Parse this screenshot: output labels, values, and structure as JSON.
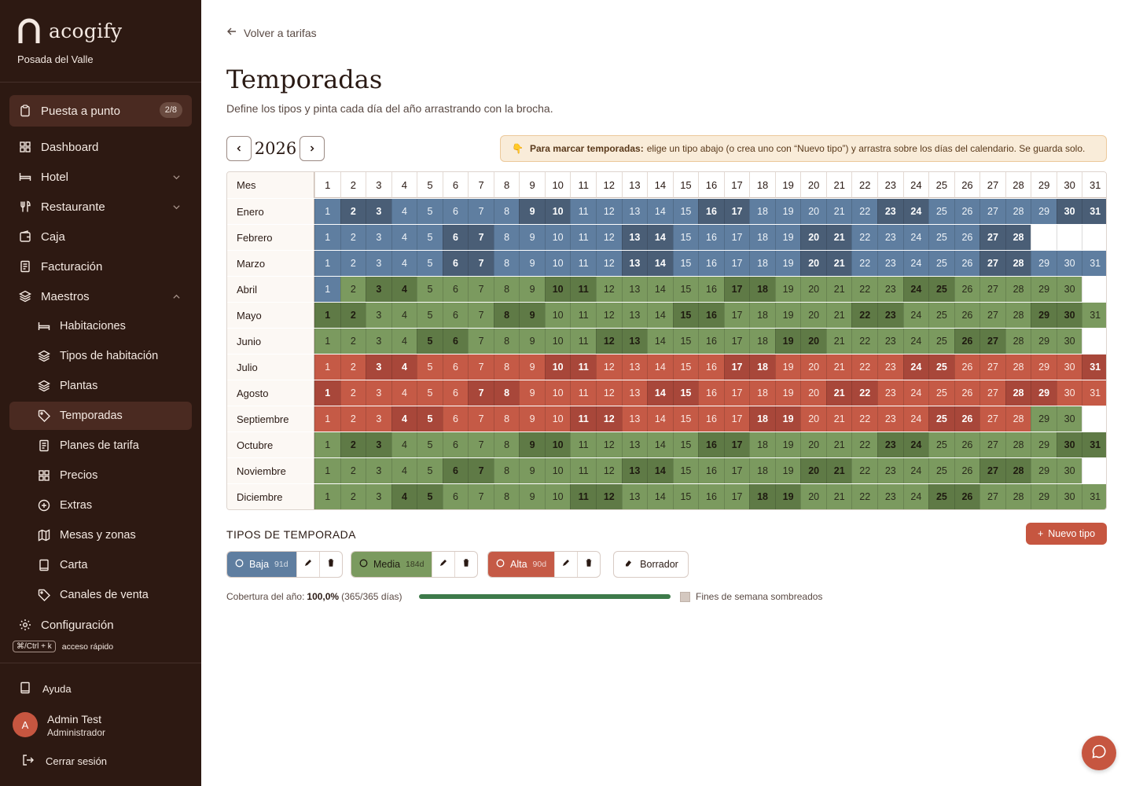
{
  "sidebar": {
    "brand": "acogify",
    "hotel": "Posada del Valle",
    "setup": {
      "label": "Puesta a punto",
      "badge": "2/8"
    },
    "items": [
      {
        "label": "Dashboard",
        "icon": "grid-icon"
      },
      {
        "label": "Hotel",
        "icon": "bed-icon"
      },
      {
        "label": "Restaurante",
        "icon": "utensils-icon"
      },
      {
        "label": "Caja",
        "icon": "wallet-icon"
      },
      {
        "label": "Facturación",
        "icon": "receipt-icon"
      },
      {
        "label": "Maestros",
        "icon": "layers-icon"
      },
      {
        "label": "Habitaciones",
        "icon": "bed-icon"
      },
      {
        "label": "Tipos de habitación",
        "icon": "layers-icon"
      },
      {
        "label": "Plantas",
        "icon": "layers-icon"
      },
      {
        "label": "Temporadas",
        "icon": "tag-icon"
      },
      {
        "label": "Planes de tarifa",
        "icon": "document-icon"
      },
      {
        "label": "Precios",
        "icon": "grid-icon"
      },
      {
        "label": "Extras",
        "icon": "plus-circle-icon"
      },
      {
        "label": "Mesas y zonas",
        "icon": "map-icon"
      },
      {
        "label": "Carta",
        "icon": "book-icon"
      },
      {
        "label": "Canales de venta",
        "icon": "tag-icon"
      },
      {
        "label": "Configuración",
        "icon": "gear-icon"
      }
    ],
    "shortcut": {
      "key": "⌘/Ctrl + k",
      "label": "acceso rápido"
    },
    "help": "Ayuda",
    "user": {
      "initial": "A",
      "name": "Admin Test",
      "role": "Administrador"
    },
    "logout": "Cerrar sesión"
  },
  "page": {
    "back": "Volver a tarifas",
    "title": "Temporadas",
    "subtitle": "Define los tipos y pinta cada día del año arrastrando con la brocha.",
    "year": "2026",
    "hint_icon": "👇",
    "hint_bold": "Para marcar temporadas:",
    "hint_text": "elige un tipo abajo (o crea uno con “Nuevo tipo”) y arrastra sobre los días del calendario. Se guarda solo."
  },
  "calendar": {
    "header_label": "Mes",
    "months": [
      "Enero",
      "Febrero",
      "Marzo",
      "Abril",
      "Mayo",
      "Junio",
      "Julio",
      "Agosto",
      "Septiembre",
      "Octubre",
      "Noviembre",
      "Diciembre"
    ],
    "days_in_month": [
      31,
      28,
      31,
      30,
      31,
      30,
      31,
      31,
      30,
      31,
      30,
      31
    ],
    "first_weekday_2026": 4,
    "season_by_month": [
      "baja",
      "baja",
      "baja",
      "media",
      "media",
      "media",
      "alta",
      "alta",
      "alta",
      "media",
      "media",
      "media"
    ],
    "overrides": {
      "Abril": {
        "1": "baja"
      },
      "Septiembre": {
        "29": "media",
        "30": "media"
      }
    }
  },
  "seasons": {
    "section_title": "TIPOS DE TEMPORADA",
    "new_button": "Nuevo tipo",
    "types": [
      {
        "key": "baja",
        "name": "Baja",
        "count": "91d",
        "color": "#5f7ea0",
        "bg": "#5f7ea0",
        "fg": "#ffffff"
      },
      {
        "key": "media",
        "name": "Media",
        "count": "184d",
        "color": "#7b9a5f",
        "bg": "#7b9a5f",
        "fg": "#1e1a10"
      },
      {
        "key": "alta",
        "name": "Alta",
        "count": "90d",
        "color": "#c55a46",
        "bg": "#c55a46",
        "fg": "#ffffff"
      }
    ],
    "eraser": "Borrador"
  },
  "coverage": {
    "label": "Cobertura del año:",
    "percent": "100,0%",
    "detail": "(365/365 días)",
    "fraction": 1.0,
    "weekend_label": "Fines de semana sombreados"
  },
  "colors": {
    "sidebar": "#2d1912",
    "accent": "#c65640",
    "progress": "#3d7a4a"
  }
}
